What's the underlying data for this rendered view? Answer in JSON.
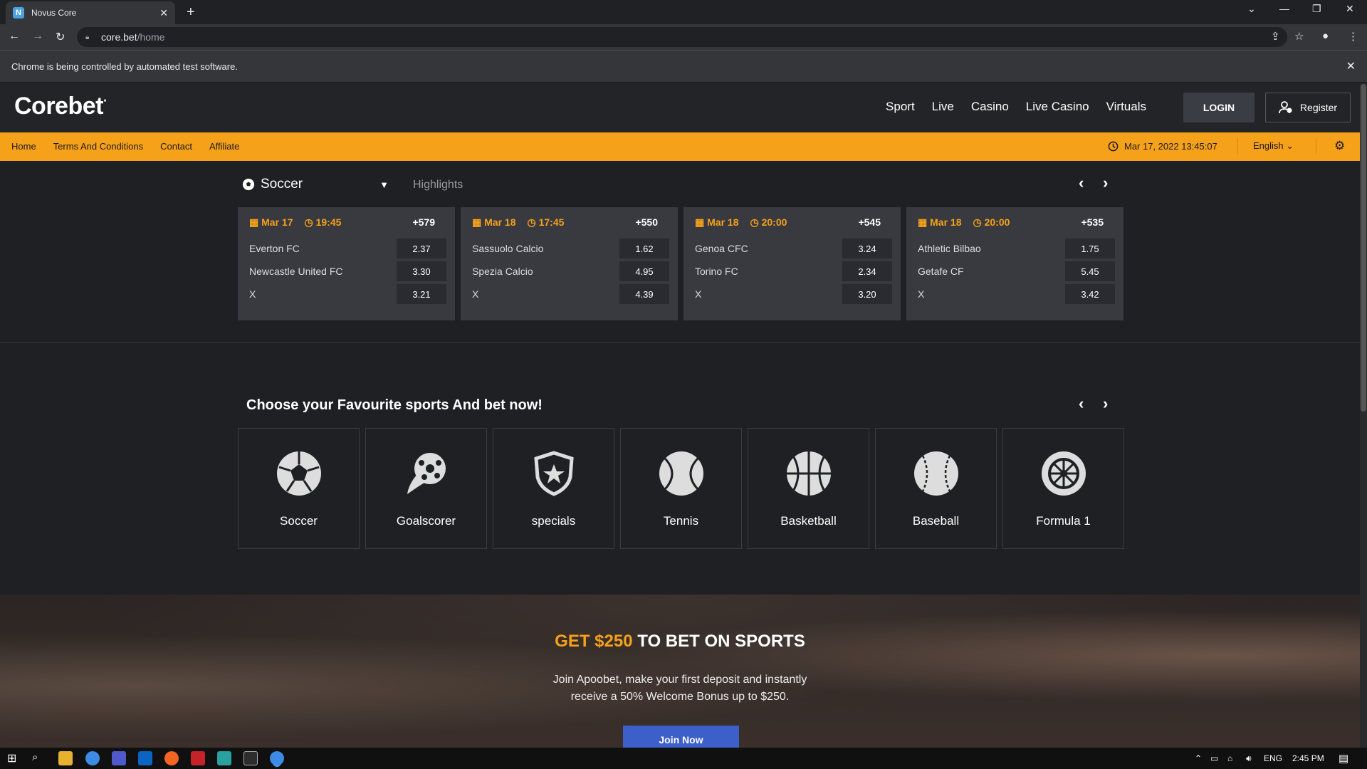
{
  "browser": {
    "tab_title": "Novus Core",
    "url_host": "core.bet",
    "url_path": "/home",
    "infobar_text": "Chrome is being controlled by automated test software."
  },
  "header": {
    "logo": "Corebet",
    "nav": [
      "Sport",
      "Live",
      "Casino",
      "Live Casino",
      "Virtuals"
    ],
    "login_label": "LOGIN",
    "register_label": "Register"
  },
  "subnav": {
    "links": [
      "Home",
      "Terms And Conditions",
      "Contact",
      "Affiliate"
    ],
    "datetime": "Mar 17, 2022 13:45:07",
    "language": "English"
  },
  "highlights": {
    "sport": "Soccer",
    "tab": "Highlights",
    "matches": [
      {
        "date": "Mar 17",
        "time": "19:45",
        "more": "+579",
        "rows": [
          {
            "team": "Everton FC",
            "odd": "2.37"
          },
          {
            "team": "Newcastle United FC",
            "odd": "3.30"
          },
          {
            "team": "X",
            "odd": "3.21"
          }
        ]
      },
      {
        "date": "Mar 18",
        "time": "17:45",
        "more": "+550",
        "rows": [
          {
            "team": "Sassuolo Calcio",
            "odd": "1.62"
          },
          {
            "team": "Spezia Calcio",
            "odd": "4.95"
          },
          {
            "team": "X",
            "odd": "4.39"
          }
        ]
      },
      {
        "date": "Mar 18",
        "time": "20:00",
        "more": "+545",
        "rows": [
          {
            "team": "Genoa CFC",
            "odd": "3.24"
          },
          {
            "team": "Torino FC",
            "odd": "2.34"
          },
          {
            "team": "X",
            "odd": "3.20"
          }
        ]
      },
      {
        "date": "Mar 18",
        "time": "20:00",
        "more": "+535",
        "rows": [
          {
            "team": "Athletic Bilbao",
            "odd": "1.75"
          },
          {
            "team": "Getafe CF",
            "odd": "5.45"
          },
          {
            "team": "X",
            "odd": "3.42"
          }
        ]
      }
    ]
  },
  "favourites": {
    "title": "Choose your Favourite sports And bet now!",
    "sports": [
      {
        "name": "Soccer",
        "icon": "soccer-ball-icon"
      },
      {
        "name": "Goalscorer",
        "icon": "goalscorer-icon"
      },
      {
        "name": "specials",
        "icon": "shield-star-icon"
      },
      {
        "name": "Tennis",
        "icon": "tennis-ball-icon"
      },
      {
        "name": "Basketball",
        "icon": "basketball-icon"
      },
      {
        "name": "Baseball",
        "icon": "baseball-icon"
      },
      {
        "name": "Formula 1",
        "icon": "wheel-icon"
      }
    ]
  },
  "promo": {
    "title_highlight": "GET $250",
    "title_rest": " TO BET ON SPORTS",
    "line1": "Join Apoobet, make your first deposit and instantly",
    "line2": "receive a 50% Welcome Bonus up to $250.",
    "button": "Join Now"
  },
  "taskbar": {
    "lang": "ENG",
    "time": "2:45 PM"
  },
  "colors": {
    "accent": "#f6a11a",
    "page_bg": "#1f2024",
    "card_bg": "#383a40",
    "join_button": "#3d5fc9"
  }
}
